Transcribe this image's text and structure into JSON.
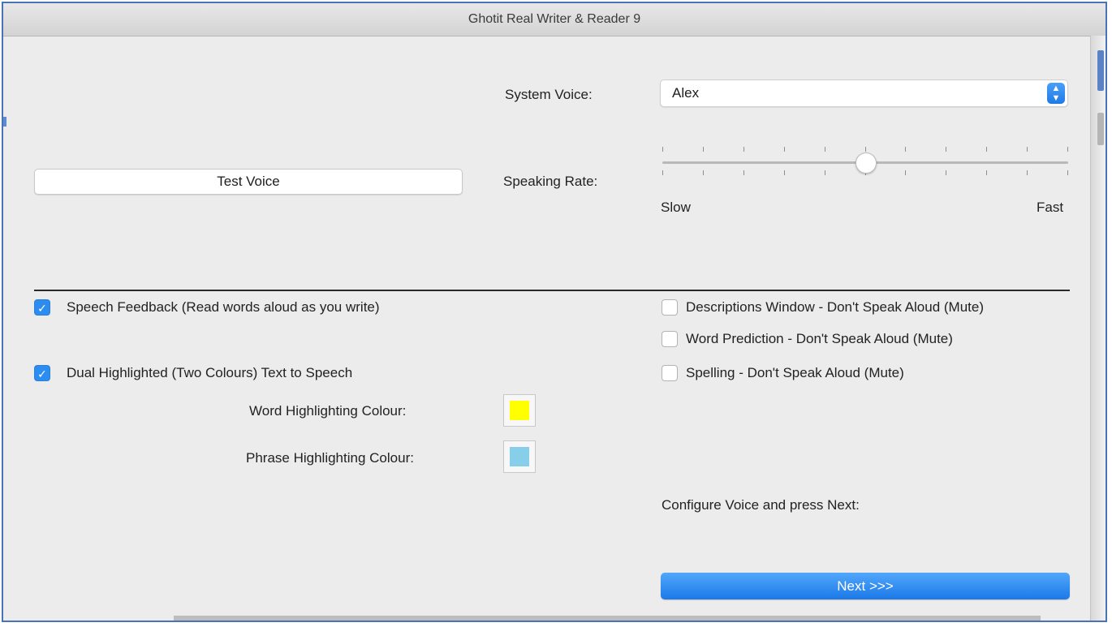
{
  "window": {
    "title": "Ghotit Real Writer & Reader 9"
  },
  "voice": {
    "system_voice_label": "System Voice:",
    "system_voice_value": "Alex",
    "test_button": "Test Voice",
    "speaking_rate_label": "Speaking Rate:",
    "rate_min_label": "Slow",
    "rate_max_label": "Fast",
    "rate_ticks": 11,
    "rate_value": 0.5
  },
  "options_left": [
    {
      "label": "Speech Feedback (Read words aloud as you write)",
      "checked": true
    },
    {
      "label": "Dual Highlighted (Two Colours) Text to Speech",
      "checked": true
    }
  ],
  "colours": {
    "word_label": "Word Highlighting Colour:",
    "word_color": "#ffff00",
    "phrase_label": "Phrase Highlighting Colour:",
    "phrase_color": "#87ceeb"
  },
  "options_right": [
    {
      "label": "Descriptions Window - Don't Speak Aloud (Mute)",
      "checked": false
    },
    {
      "label": "Word Prediction - Don't Speak Aloud (Mute)",
      "checked": false
    },
    {
      "label": "Spelling - Don't Speak Aloud (Mute)",
      "checked": false
    }
  ],
  "footer": {
    "instruction": "Configure Voice and press Next:",
    "next_button": "Next >>>"
  },
  "colors": {
    "accent": "#2d8cf0",
    "frame": "#4a72b8"
  }
}
